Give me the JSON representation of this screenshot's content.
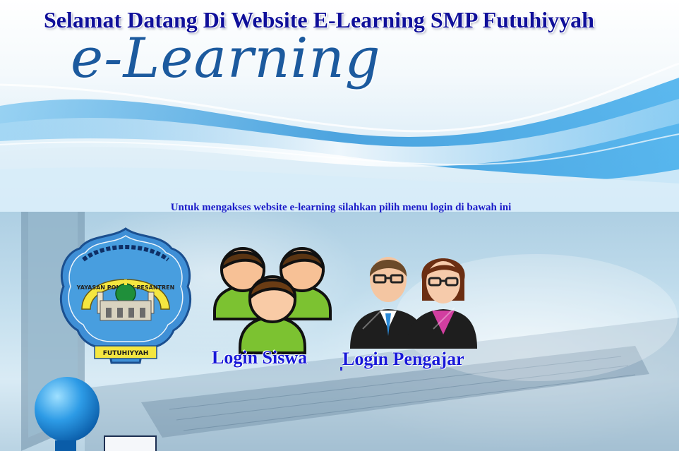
{
  "header": {
    "title": "Selamat Datang Di Website E-Learning SMP Futuhiyyah",
    "brand": "e-Learning"
  },
  "main": {
    "instruction": "Untuk mengakses website e-learning silahkan pilih menu login di bawah ini",
    "login_student_label": "Login Siswa",
    "login_teacher_label": "Login Pengajar"
  },
  "emblem": {
    "arc_text": "YAYASAN PONDOK PESANTREN",
    "banner_text": "FUTUHIYYAH"
  },
  "colors": {
    "title": "#10109a",
    "link": "#1818d8",
    "brand": "#1c5a9e",
    "wave": "#1a8ad6"
  },
  "icons": [
    "students-group-icon",
    "teachers-pair-icon",
    "school-emblem-icon",
    "blue-ball-icon"
  ]
}
